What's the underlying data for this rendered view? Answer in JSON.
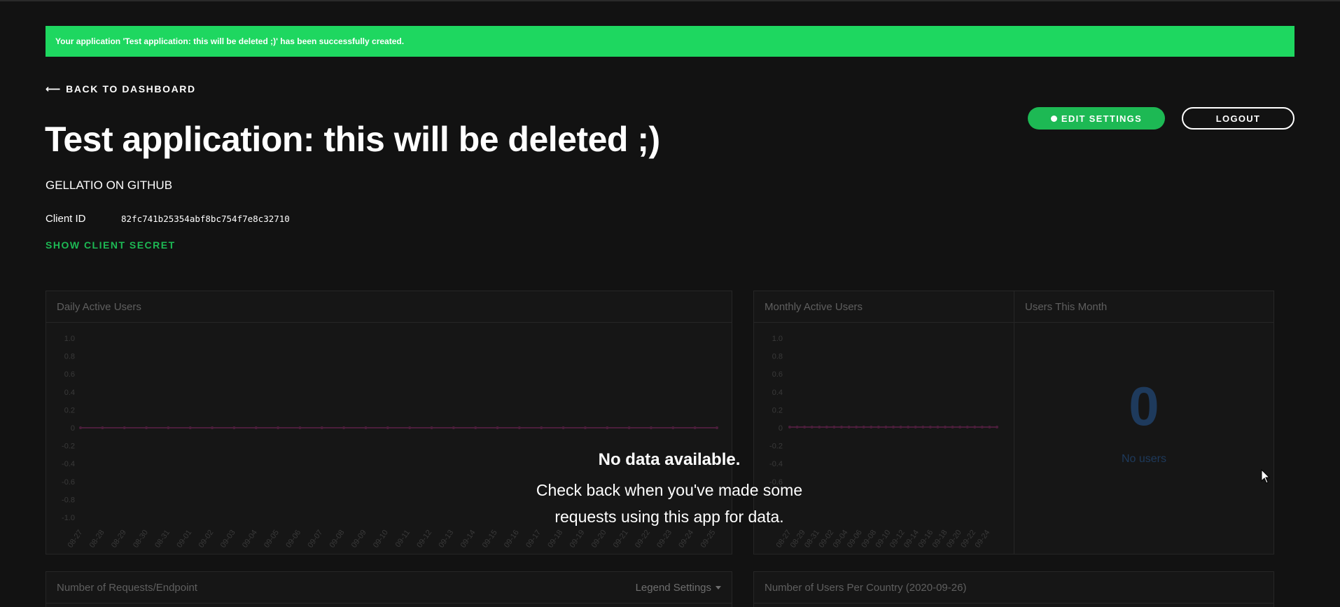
{
  "banner": {
    "message": "Your application 'Test application: this will be deleted ;)' has been successfully created.",
    "color": "#1ed760"
  },
  "nav": {
    "back_label": "BACK TO DASHBOARD",
    "back_icon": "arrow-left-icon"
  },
  "actions": {
    "edit_label": "EDIT SETTINGS",
    "logout_label": "LOGOUT"
  },
  "app": {
    "title": "Test application: this will be deleted ;)",
    "owner": "GELLATIO ON GITHUB",
    "client_id_label": "Client ID",
    "client_id": "82fc741b25354abf8bc754f7e8c32710",
    "show_secret_label": "SHOW CLIENT SECRET"
  },
  "colors": {
    "accent": "#1db954",
    "series": "#4b1e3b",
    "muted_number": "#1e3a5c"
  },
  "panels": {
    "daily_title": "Daily Active Users",
    "monthly_title": "Monthly Active Users",
    "users_month_title": "Users This Month",
    "users_month_value": "0",
    "users_month_caption": "No users",
    "requests_title": "Number of Requests/Endpoint",
    "legend_settings_label": "Legend Settings",
    "country_title": "Number of Users Per Country (2020-09-26)"
  },
  "empty_state": {
    "title": "No data available.",
    "line1": "Check back when you've made some",
    "line2": "requests using this app for data."
  },
  "chart_data": [
    {
      "type": "line",
      "title": "Daily Active Users",
      "x": [
        "08-27",
        "08-28",
        "08-29",
        "08-30",
        "08-31",
        "09-01",
        "09-02",
        "09-03",
        "09-04",
        "09-05",
        "09-06",
        "09-07",
        "09-08",
        "09-09",
        "09-10",
        "09-11",
        "09-12",
        "09-13",
        "09-14",
        "09-15",
        "09-16",
        "09-17",
        "09-18",
        "09-19",
        "09-20",
        "09-21",
        "09-22",
        "09-23",
        "09-24",
        "09-25"
      ],
      "y_ticks": [
        "1.0",
        "0.8",
        "0.6",
        "0.4",
        "0.2",
        "0",
        "-0.2",
        "-0.4",
        "-0.6",
        "-0.8",
        "-1.0"
      ],
      "ylim": [
        -1,
        1
      ],
      "series": [
        {
          "values": [
            0,
            0,
            0,
            0,
            0,
            0,
            0,
            0,
            0,
            0,
            0,
            0,
            0,
            0,
            0,
            0,
            0,
            0,
            0,
            0,
            0,
            0,
            0,
            0,
            0,
            0,
            0,
            0,
            0,
            0
          ]
        }
      ]
    },
    {
      "type": "line",
      "title": "Monthly Active Users",
      "x": [
        "08-27",
        "08-29",
        "08-31",
        "09-02",
        "09-04",
        "09-06",
        "09-08",
        "09-10",
        "09-12",
        "09-14",
        "09-16",
        "09-18",
        "09-20",
        "09-22",
        "09-24"
      ],
      "y_ticks": [
        "1.0",
        "0.8",
        "0.6",
        "0.4",
        "0.2",
        "0",
        "-0.2",
        "-0.4",
        "-0.6"
      ],
      "ylim": [
        -1,
        1
      ],
      "series": [
        {
          "values": [
            0,
            0,
            0,
            0,
            0,
            0,
            0,
            0,
            0,
            0,
            0,
            0,
            0,
            0,
            0,
            0,
            0,
            0,
            0,
            0,
            0,
            0,
            0,
            0,
            0,
            0,
            0,
            0,
            0
          ]
        }
      ]
    }
  ]
}
